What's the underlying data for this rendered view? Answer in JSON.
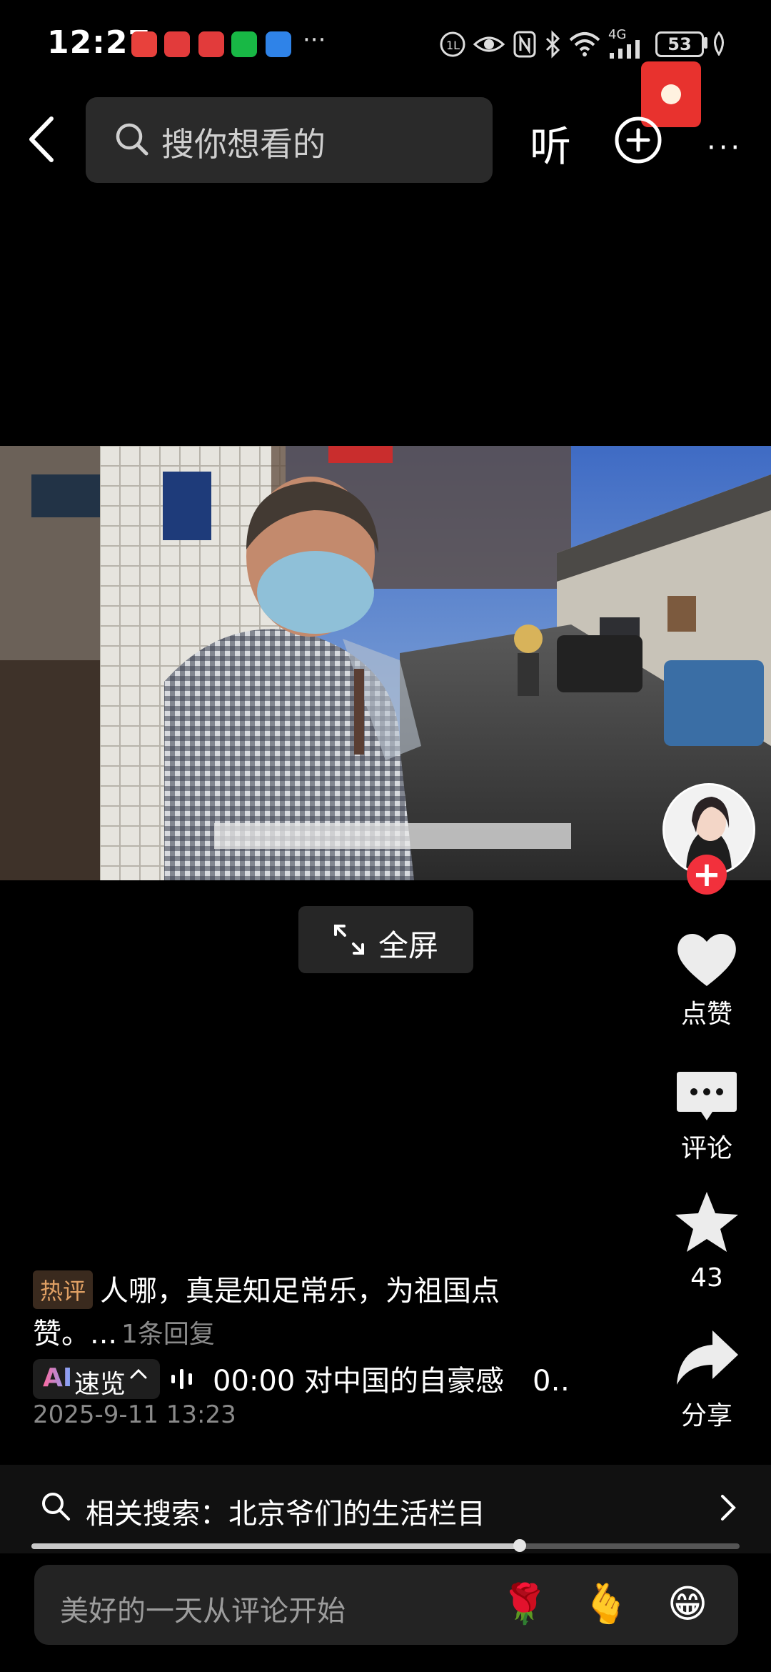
{
  "status_bar": {
    "time": "12:27",
    "more": "···",
    "network": "4G",
    "battery": "53"
  },
  "top_nav": {
    "search_placeholder": "搜你想看的",
    "listen_label": "听",
    "more_label": "···"
  },
  "video": {
    "fullscreen_label": "全屏"
  },
  "right_rail": {
    "like_label": "点赞",
    "comment_label": "评论",
    "favorite_count": "43",
    "share_label": "分享"
  },
  "hot_comment": {
    "badge": "热评",
    "line1": "人哪，真是知足常乐，为祖国点",
    "line2": "赞。...",
    "reply_count": "1条回复"
  },
  "ai_summary": {
    "ai_label": "AI",
    "chip_text": "速览",
    "text": "00:00 对中国的自豪感　0‥"
  },
  "publish_date": "2025-9-11 13:23",
  "related_search": {
    "text": "相关搜索：北京爷们的生活栏目"
  },
  "progress": {
    "value": 0.69
  },
  "comment_input": {
    "placeholder": "美好的一天从评论开始",
    "emojis": [
      "🌹",
      "🫰",
      "😁"
    ]
  },
  "colors": {
    "accent_red": "#f2303c",
    "hot_badge": "#e0a064",
    "ai_gradient_start": "#ff6aa0",
    "ai_gradient_end": "#7aa8ff"
  }
}
